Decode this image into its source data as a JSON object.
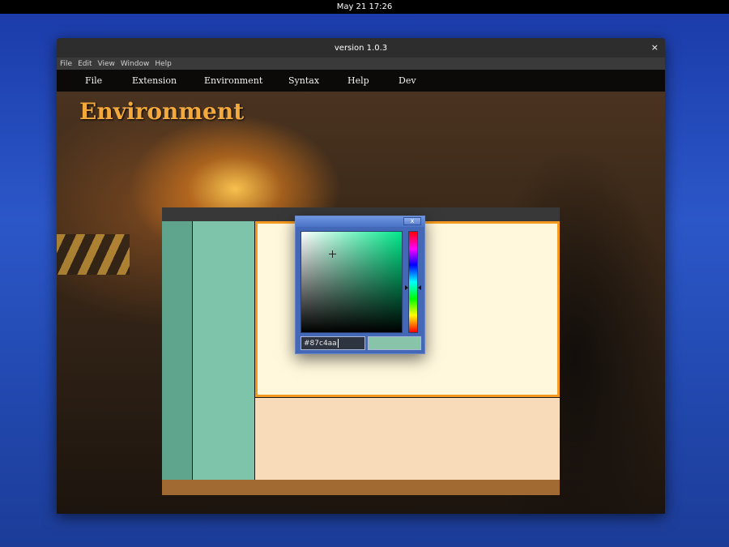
{
  "system": {
    "clock": "May 21  17:26"
  },
  "window": {
    "title": "version 1.0.3",
    "close_glyph": "×"
  },
  "menubar": [
    "File",
    "Edit",
    "View",
    "Window",
    "Help"
  ],
  "app_nav": [
    "File",
    "Extension",
    "Environment",
    "Syntax",
    "Help",
    "Dev"
  ],
  "page": {
    "title": "Environment"
  },
  "color_picker": {
    "close_glyph": "x",
    "hex_value": "#87c4aa",
    "swatch_color": "#87c4aa",
    "hue_base": "#00e88a"
  },
  "preview_colors": {
    "top_bar": "#383838",
    "column_1": "#5fa48c",
    "column_2": "#7ec4aa",
    "editor_bg": "#fff8dc",
    "editor_border": "#f49a20",
    "lower_panel": "#f8dbb9",
    "status_bar": "#a06a32"
  },
  "icons": {
    "window_close": "close-icon",
    "picker_close": "close-icon",
    "crosshair": "crosshair-icon"
  }
}
